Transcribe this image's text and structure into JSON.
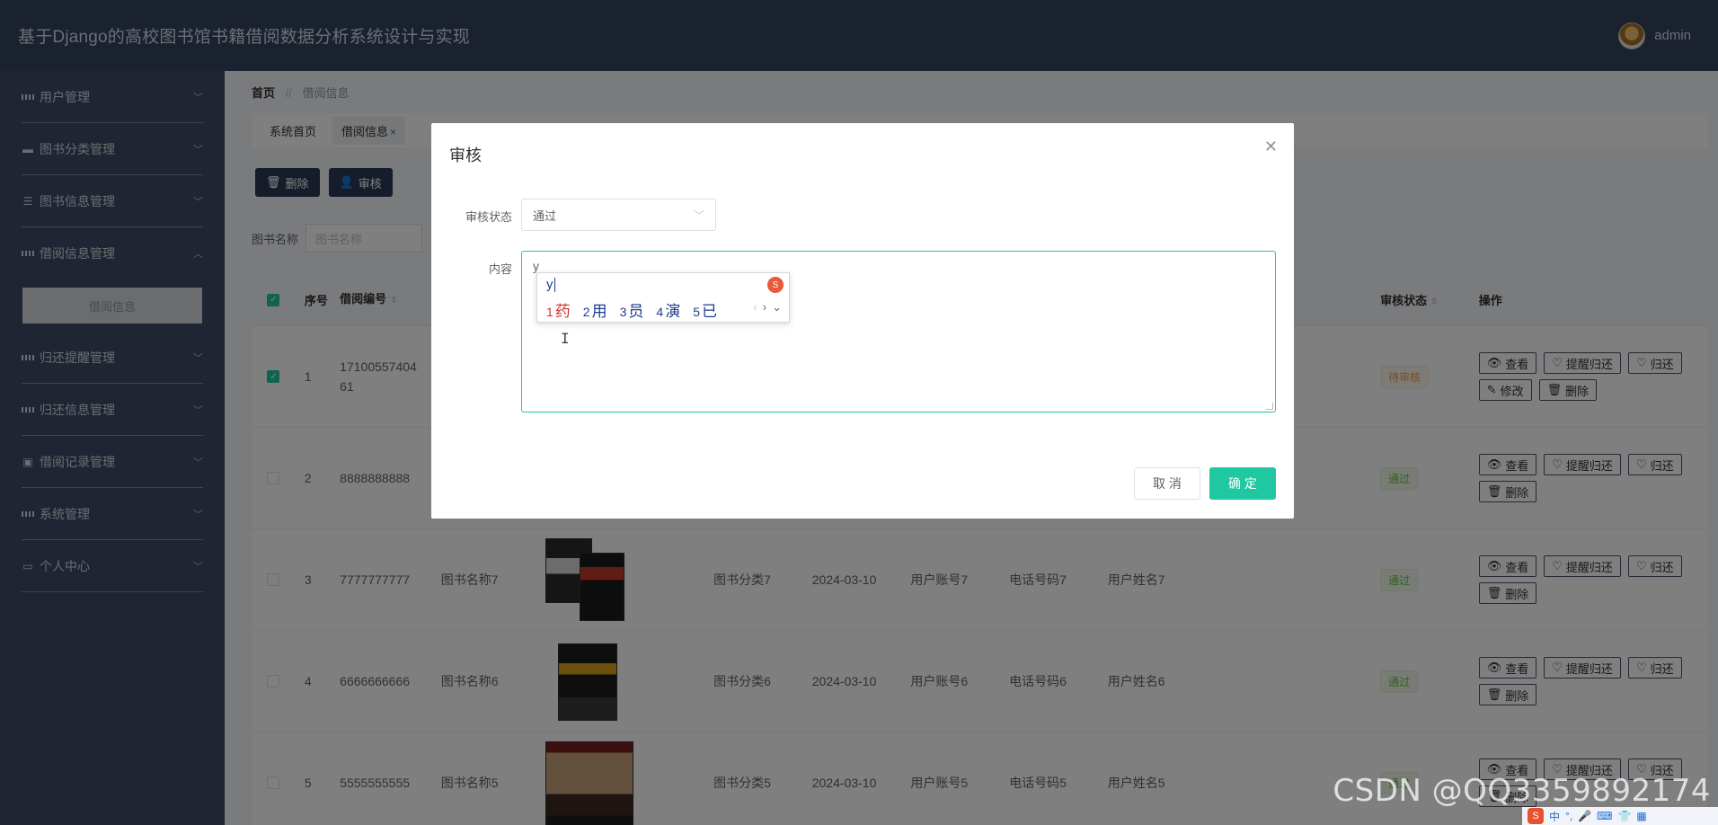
{
  "header": {
    "title": "基于Django的高校图书馆书籍借阅数据分析系统设计与实现",
    "username": "admin"
  },
  "sidebar": {
    "items": [
      {
        "label": "用户管理",
        "icon": "grid-icon"
      },
      {
        "label": "图书分类管理",
        "icon": "pin-icon"
      },
      {
        "label": "图书信息管理",
        "icon": "list-icon"
      },
      {
        "label": "借阅信息管理",
        "icon": "grid-icon",
        "expanded": true
      },
      {
        "label": "归还提醒管理",
        "icon": "grid-icon"
      },
      {
        "label": "归还信息管理",
        "icon": "grid-icon"
      },
      {
        "label": "借阅记录管理",
        "icon": "clipboard-icon"
      },
      {
        "label": "系统管理",
        "icon": "grid-icon"
      },
      {
        "label": "个人中心",
        "icon": "window-icon"
      }
    ],
    "active_sub": "借阅信息"
  },
  "breadcrumb": {
    "home": "首页",
    "sep": "//",
    "current": "借阅信息"
  },
  "tabs": [
    {
      "label": "系统首页"
    },
    {
      "label": "借阅信息"
    }
  ],
  "toolbar": {
    "delete": "删除",
    "review": "审核"
  },
  "search": {
    "label": "图书名称",
    "placeholder": "图书名称"
  },
  "table": {
    "headers": {
      "no": "序号",
      "code": "借阅编号",
      "status": "审核状态",
      "ops": "操作"
    },
    "rows": [
      {
        "no": "1",
        "code_a": "17100557404",
        "code_b": "61",
        "name": "",
        "category": "",
        "date": "",
        "account": "",
        "phone": "",
        "uname": "",
        "status": "待审核",
        "status_kind": "pending",
        "checked": true,
        "ops": [
          "查看",
          "提醒归还",
          "归还",
          "修改",
          "删除"
        ]
      },
      {
        "no": "2",
        "code_a": "8888888888",
        "code_b": "",
        "name": "",
        "category": "",
        "date": "",
        "account": "",
        "phone": "",
        "uname": "",
        "status": "通过",
        "status_kind": "pass",
        "checked": false,
        "ops": [
          "查看",
          "提醒归还",
          "归还",
          "删除"
        ]
      },
      {
        "no": "3",
        "code_a": "7777777777",
        "code_b": "",
        "name": "图书名称7",
        "category": "图书分类7",
        "date": "2024-03-10",
        "account": "用户账号7",
        "phone": "电话号码7",
        "uname": "用户姓名7",
        "status": "通过",
        "status_kind": "pass",
        "checked": false,
        "ops": [
          "查看",
          "提醒归还",
          "归还",
          "删除"
        ]
      },
      {
        "no": "4",
        "code_a": "6666666666",
        "code_b": "",
        "name": "图书名称6",
        "category": "图书分类6",
        "date": "2024-03-10",
        "account": "用户账号6",
        "phone": "电话号码6",
        "uname": "用户姓名6",
        "status": "通过",
        "status_kind": "pass",
        "checked": false,
        "ops": [
          "查看",
          "提醒归还",
          "归还",
          "删除"
        ]
      },
      {
        "no": "5",
        "code_a": "5555555555",
        "code_b": "",
        "name": "图书名称5",
        "category": "图书分类5",
        "date": "2024-03-10",
        "account": "用户账号5",
        "phone": "电话号码5",
        "uname": "用户姓名5",
        "status": "通过",
        "status_kind": "pass",
        "checked": false,
        "ops": [
          "查看",
          "提醒归还",
          "归还",
          "删除"
        ]
      }
    ]
  },
  "dialog": {
    "title": "审核",
    "status_label": "审核状态",
    "status_value": "通过",
    "content_label": "内容",
    "content_value": "y",
    "cancel": "取 消",
    "confirm": "确 定"
  },
  "ime": {
    "pinyin": "y",
    "candidates": [
      {
        "n": "1",
        "c": "药"
      },
      {
        "n": "2",
        "c": "用"
      },
      {
        "n": "3",
        "c": "员"
      },
      {
        "n": "4",
        "c": "演"
      },
      {
        "n": "5",
        "c": "已"
      }
    ]
  },
  "watermark": "CSDN @QQ3359892174",
  "tray": {
    "lang": "中"
  }
}
